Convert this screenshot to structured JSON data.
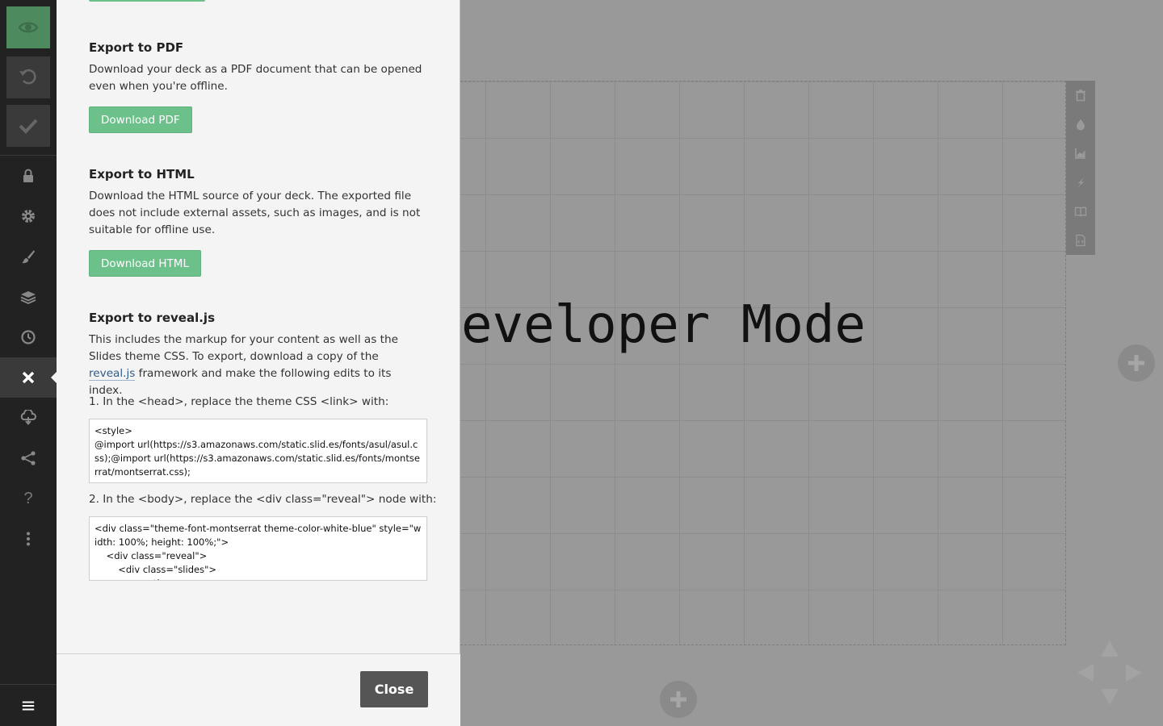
{
  "sidebar": {
    "top_buttons": [
      "preview-icon",
      "undo-icon",
      "check-icon"
    ],
    "items": [
      {
        "icon": "lock-icon"
      },
      {
        "icon": "gear-icon"
      },
      {
        "icon": "brush-icon"
      },
      {
        "icon": "layers-icon"
      },
      {
        "icon": "clock-icon"
      },
      {
        "icon": "close-icon",
        "active": true
      },
      {
        "icon": "cloud-download-icon"
      },
      {
        "icon": "share-icon"
      },
      {
        "icon": "help-icon",
        "glyph": "?"
      },
      {
        "icon": "more-icon"
      }
    ],
    "menu_icon": "hamburger-icon"
  },
  "panel": {
    "pdf": {
      "title": "Export to PDF",
      "desc": "Download your deck as a PDF document that can be opened even when you're offline.",
      "button": "Download PDF"
    },
    "html": {
      "title": "Export to HTML",
      "desc": "Download the HTML source of your deck. The exported file does not include external assets, such as images, and is not suitable for offline use.",
      "button": "Download HTML"
    },
    "reveal": {
      "title": "Export to reveal.js",
      "desc_before": "This includes the markup for your content as well as the Slides theme CSS. To export, download a copy of the ",
      "desc_link": "reveal.js",
      "desc_after": " framework and make the following edits to its index.",
      "step1": "1. In the <head>, replace the theme CSS <link> with:",
      "code1": "<style>\n@import url(https://s3.amazonaws.com/static.slid.es/fonts/asul/asul.css);@import url(https://s3.amazonaws.com/static.slid.es/fonts/montserrat/montserrat.css);",
      "step2": "2. In the <body>, replace the <div class=\"reveal\"> node with:",
      "code2": "<div class=\"theme-font-montserrat theme-color-white-blue\" style=\"width: 100%; height: 100%;\">\n    <div class=\"reveal\">\n        <div class=\"slides\">\n            <section>"
    },
    "close_button": "Close"
  },
  "slide": {
    "text": "eveloper Mode"
  },
  "slide_toolbar": [
    "trash-icon",
    "drop-icon",
    "chart-icon",
    "bolt-icon",
    "book-icon",
    "code-icon"
  ]
}
